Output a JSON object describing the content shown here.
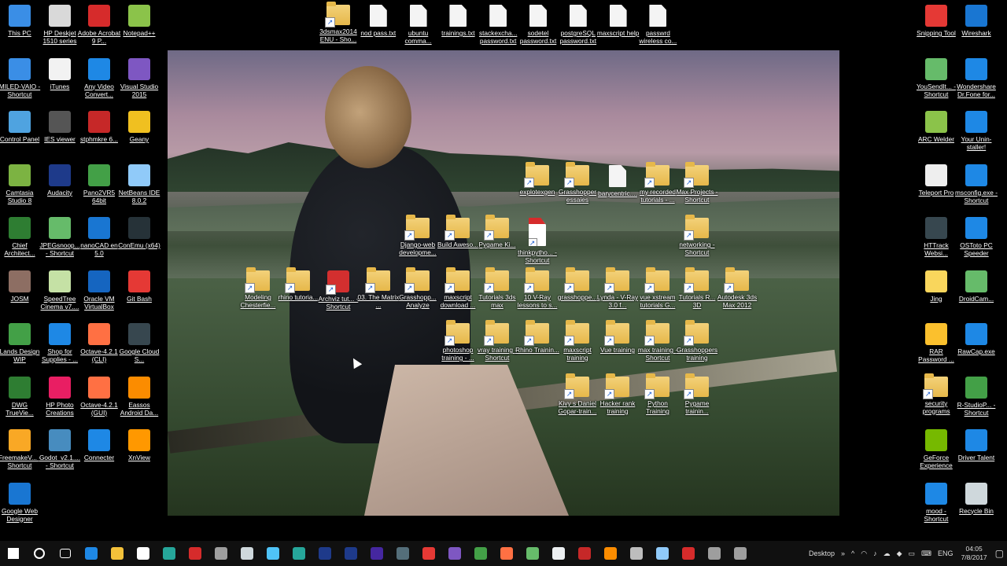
{
  "desktop": {
    "left_icons": [
      {
        "label": "This PC",
        "icon": "computer-icon",
        "color": "#3a8ee6"
      },
      {
        "label": "HP Deskjet 1510 series",
        "icon": "printer-icon",
        "color": "#d9d9d9"
      },
      {
        "label": "Adobe Acrobat 9 P...",
        "icon": "acrobat-icon",
        "color": "#d62b2b"
      },
      {
        "label": "Notepad++",
        "icon": "notepadpp-icon",
        "color": "#8bc34a"
      },
      {
        "label": "MILED-VAIO - Shortcut",
        "icon": "network-computer-icon",
        "color": "#3a8ee6"
      },
      {
        "label": "iTunes",
        "icon": "itunes-icon",
        "color": "#f2f2f2"
      },
      {
        "label": "Any Video Convert...",
        "icon": "video-converter-icon",
        "color": "#1e88e5"
      },
      {
        "label": "Visual Studio 2015",
        "icon": "visual-studio-icon",
        "color": "#7e57c2"
      },
      {
        "label": "Control Panel",
        "icon": "control-panel-icon",
        "color": "#4fa3e0"
      },
      {
        "label": "IES viewer",
        "icon": "ies-viewer-icon",
        "color": "#555555"
      },
      {
        "label": "stphmkre 6...",
        "icon": "3d-icon",
        "color": "#c62828"
      },
      {
        "label": "Geany",
        "icon": "geany-icon",
        "color": "#f0c020"
      },
      {
        "label": "Camtasia Studio 8",
        "icon": "camtasia-icon",
        "color": "#7cb342"
      },
      {
        "label": "Audacity",
        "icon": "audacity-icon",
        "color": "#1e3a8a"
      },
      {
        "label": "Pano2VR5 64bit",
        "icon": "pano2vr-icon",
        "color": "#43a047"
      },
      {
        "label": "NetBeans IDE 8.0.2",
        "icon": "netbeans-icon",
        "color": "#90caf9"
      },
      {
        "label": "Chief Architect...",
        "icon": "chief-architect-icon",
        "color": "#2e7d32"
      },
      {
        "label": "JPEGsnoop... - Shortcut",
        "icon": "jpegsnoop-icon",
        "color": "#66bb6a"
      },
      {
        "label": "nanoCAD en 5.0",
        "icon": "nanocad-icon",
        "color": "#1976d2"
      },
      {
        "label": "ConEmu (x64)",
        "icon": "conemu-icon",
        "color": "#263238"
      },
      {
        "label": "JOSM",
        "icon": "josm-icon",
        "color": "#8d6e63"
      },
      {
        "label": "SpeedTree Cinema v7....",
        "icon": "speedtree-icon",
        "color": "#c5e1a5"
      },
      {
        "label": "Oracle VM VirtualBox",
        "icon": "virtualbox-icon",
        "color": "#1565c0"
      },
      {
        "label": "Git Bash",
        "icon": "git-bash-icon",
        "color": "#e53935"
      },
      {
        "label": "Lands Design WIP",
        "icon": "lands-design-icon",
        "color": "#43a047"
      },
      {
        "label": "Shop for Supplies - ...",
        "icon": "shop-supplies-icon",
        "color": "#1e88e5"
      },
      {
        "label": "Octave-4.2.1 (CLI)",
        "icon": "octave-icon",
        "color": "#ff7043"
      },
      {
        "label": "Google Cloud S...",
        "icon": "terminal-icon",
        "color": "#37474f"
      },
      {
        "label": "DWG TrueVie...",
        "icon": "dwg-icon",
        "color": "#2e7d32"
      },
      {
        "label": "HP Photo Creations",
        "icon": "hp-photo-icon",
        "color": "#e91e63"
      },
      {
        "label": "Octave-4.2.1 (GUI)",
        "icon": "octave-icon",
        "color": "#ff7043"
      },
      {
        "label": "Eassos Android Da...",
        "icon": "eassos-icon",
        "color": "#fb8c00"
      },
      {
        "label": "FreemakeV... - Shortcut",
        "icon": "freemake-icon",
        "color": "#f9a825"
      },
      {
        "label": "Godot_v2.1.... - Shortcut",
        "icon": "godot-icon",
        "color": "#478cbf"
      },
      {
        "label": "Connecter",
        "icon": "connecter-icon",
        "color": "#1e88e5"
      },
      {
        "label": "XnView",
        "icon": "xnview-icon",
        "color": "#ff9800"
      },
      {
        "label": "Google Web Designer",
        "icon": "google-web-designer-icon",
        "color": "#1976d2"
      }
    ],
    "top_icons": [
      {
        "label": "3dsmax2014 ENU - Sho...",
        "icon": "folder-shortcut-icon"
      },
      {
        "label": "nod pass.txt",
        "icon": "text-file-icon"
      },
      {
        "label": "ubuntu comma...",
        "icon": "text-file-icon"
      },
      {
        "label": "trainings.txt",
        "icon": "text-file-icon"
      },
      {
        "label": "stackexcha... password.txt",
        "icon": "text-file-icon"
      },
      {
        "label": "sodetel password.txt",
        "icon": "text-file-icon"
      },
      {
        "label": "postgreSQL password.txt",
        "icon": "text-file-icon"
      },
      {
        "label": "maxscript help",
        "icon": "text-file-icon"
      },
      {
        "label": "passwrd wireless co...",
        "icon": "text-file-icon"
      }
    ],
    "middle_icons": [
      {
        "label": "explotexgen",
        "icon": "folder-shortcut-icon"
      },
      {
        "label": "Grasshopper essaies",
        "icon": "folder-shortcut-icon"
      },
      {
        "label": "barycentric....",
        "icon": "text-file-icon"
      },
      {
        "label": "my recorded tutorials - ...",
        "icon": "folder-shortcut-icon"
      },
      {
        "label": "Max Projects - Shortcut",
        "icon": "folder-shortcut-icon"
      },
      {
        "label": "Django-web developme...",
        "icon": "folder-shortcut-icon"
      },
      {
        "label": "Build Aweso...",
        "icon": "folder-shortcut-icon"
      },
      {
        "label": "Pygame Ki...",
        "icon": "folder-shortcut-icon"
      },
      {
        "label": "thinkpytho... - Shortcut",
        "icon": "pdf-icon"
      },
      {
        "label": "networking - Shortcut",
        "icon": "folder-shortcut-icon"
      },
      {
        "label": "Modeling Chesterfie...",
        "icon": "folder-shortcut-icon"
      },
      {
        "label": "rhino tutoria...",
        "icon": "folder-shortcut-icon"
      },
      {
        "label": "Archviz tut... - Shortcut",
        "icon": "flash-icon"
      },
      {
        "label": "03. The Matrix ...",
        "icon": "folder-shortcut-icon"
      },
      {
        "label": "Grasshopp... Analyze",
        "icon": "folder-shortcut-icon"
      },
      {
        "label": "maxscript download ...",
        "icon": "folder-shortcut-icon"
      },
      {
        "label": "Tutorials 3ds max",
        "icon": "folder-shortcut-icon"
      },
      {
        "label": "10 V-Ray lessons to s...",
        "icon": "folder-shortcut-icon"
      },
      {
        "label": "grasshoppe...",
        "icon": "folder-shortcut-icon"
      },
      {
        "label": "Lynda - V-Ray 3.0 f...",
        "icon": "folder-shortcut-icon"
      },
      {
        "label": "vue xstream tutorials G...",
        "icon": "folder-shortcut-icon"
      },
      {
        "label": "Tutorials R... 3D",
        "icon": "folder-shortcut-icon"
      },
      {
        "label": "Autodesk 3ds Max 2012",
        "icon": "folder-shortcut-icon"
      },
      {
        "label": "photoshop training - ...",
        "icon": "folder-shortcut-icon"
      },
      {
        "label": "vray training - Shortcut",
        "icon": "folder-shortcut-icon"
      },
      {
        "label": "Rhino Trainin...",
        "icon": "folder-shortcut-icon"
      },
      {
        "label": "maxscript training",
        "icon": "folder-shortcut-icon"
      },
      {
        "label": "Vue training",
        "icon": "folder-shortcut-icon"
      },
      {
        "label": "max training - Shortcut",
        "icon": "folder-shortcut-icon"
      },
      {
        "label": "Grasshoppers training",
        "icon": "folder-shortcut-icon"
      },
      {
        "label": "Kivy s Daniel Gopar-train...",
        "icon": "folder-shortcut-icon"
      },
      {
        "label": "Hacker rank training",
        "icon": "folder-shortcut-icon"
      },
      {
        "label": "Python Training",
        "icon": "folder-shortcut-icon"
      },
      {
        "label": "Pygame trainin...",
        "icon": "folder-shortcut-icon"
      }
    ],
    "right_icons": [
      {
        "label": "Snipping Tool",
        "icon": "snipping-tool-icon",
        "color": "#e53935"
      },
      {
        "label": "Wireshark",
        "icon": "wireshark-icon",
        "color": "#1976d2"
      },
      {
        "label": "YouSendIt... - Shortcut",
        "icon": "yousendit-icon",
        "color": "#66bb6a"
      },
      {
        "label": "Wondershare Dr.Fone for...",
        "icon": "drfone-icon",
        "color": "#1e88e5"
      },
      {
        "label": "ARC Welder",
        "icon": "arc-welder-icon",
        "color": "#8bc34a"
      },
      {
        "label": "Your Unin-staller!",
        "icon": "uninstaller-icon",
        "color": "#1e88e5"
      },
      {
        "label": "Teleport Pro",
        "icon": "teleport-pro-icon",
        "color": "#eeeeee"
      },
      {
        "label": "msconfig.exe - Shortcut",
        "icon": "msconfig-icon",
        "color": "#1e88e5"
      },
      {
        "label": "HTTrack Websi...",
        "icon": "httrack-icon",
        "color": "#37474f"
      },
      {
        "label": "OSToto PC Speeder",
        "icon": "pc-speeder-icon",
        "color": "#1e88e5"
      },
      {
        "label": "Jing",
        "icon": "jing-icon",
        "color": "#f9d65c"
      },
      {
        "label": "DroidCam...",
        "icon": "droidcam-icon",
        "color": "#66bb6a"
      },
      {
        "label": "RAR Password ...",
        "icon": "rar-password-icon",
        "color": "#fbc02d"
      },
      {
        "label": "RawCap.exe",
        "icon": "rawcap-icon",
        "color": "#1e88e5"
      },
      {
        "label": "security programs",
        "icon": "folder-shortcut-icon",
        "color": "#e6b84a"
      },
      {
        "label": "R-StudioP... - Shortcut",
        "icon": "r-studio-icon",
        "color": "#43a047"
      },
      {
        "label": "GeForce Experience",
        "icon": "geforce-icon",
        "color": "#76b900"
      },
      {
        "label": "Driver Talent",
        "icon": "driver-talent-icon",
        "color": "#1e88e5"
      },
      {
        "label": "mood - Shortcut",
        "icon": "music-file-icon",
        "color": "#1e88e5"
      },
      {
        "label": "Recycle Bin",
        "icon": "recycle-bin-icon",
        "color": "#cfd8dc"
      }
    ]
  },
  "taskbar": {
    "apps": [
      {
        "name": "start-button",
        "color": "#ffffff"
      },
      {
        "name": "search-icon",
        "color": "#ffffff"
      },
      {
        "name": "task-view-icon",
        "color": "#ffffff"
      },
      {
        "name": "edge-icon",
        "color": "#1e88e5"
      },
      {
        "name": "file-explorer-icon",
        "color": "#f3c13a"
      },
      {
        "name": "store-icon",
        "color": "#ffffff"
      },
      {
        "name": "sketchup-icon",
        "color": "#26a69a"
      },
      {
        "name": "acrobat-icon",
        "color": "#d62b2b"
      },
      {
        "name": "rhino-icon",
        "color": "#9e9e9e"
      },
      {
        "name": "tool-icon",
        "color": "#cfd8dc"
      },
      {
        "name": "3dsmax-icon",
        "color": "#4fc3f7"
      },
      {
        "name": "sublime-icon",
        "color": "#26a69a"
      },
      {
        "name": "photoshop-icon",
        "color": "#1e3a8a"
      },
      {
        "name": "photoshop-2-icon",
        "color": "#1e3a8a"
      },
      {
        "name": "after-effects-icon",
        "color": "#4527a0"
      },
      {
        "name": "f6-icon",
        "color": "#546e7a"
      },
      {
        "name": "app-red-icon",
        "color": "#e53935"
      },
      {
        "name": "app-purple-icon",
        "color": "#7e57c2"
      },
      {
        "name": "chrome-icon",
        "color": "#43a047"
      },
      {
        "name": "firefox-icon",
        "color": "#ff7043"
      },
      {
        "name": "app-green-icon",
        "color": "#66bb6a"
      },
      {
        "name": "calculator-icon",
        "color": "#eceff1"
      },
      {
        "name": "downloader-icon",
        "color": "#c62828"
      },
      {
        "name": "app-orange-icon",
        "color": "#fb8c00"
      },
      {
        "name": "app-grey-icon",
        "color": "#bdbdbd"
      },
      {
        "name": "network-icon",
        "color": "#90caf9"
      },
      {
        "name": "acrobat-2-icon",
        "color": "#d62b2b"
      },
      {
        "name": "app-dark-icon",
        "color": "#9e9e9e"
      },
      {
        "name": "app-dark-2-icon",
        "color": "#9e9e9e"
      }
    ],
    "tray": {
      "desktop_label": "Desktop",
      "chevron": "»",
      "up_arrow": "^",
      "language": "ENG",
      "time": "04:05",
      "date": "7/8/2017"
    }
  }
}
